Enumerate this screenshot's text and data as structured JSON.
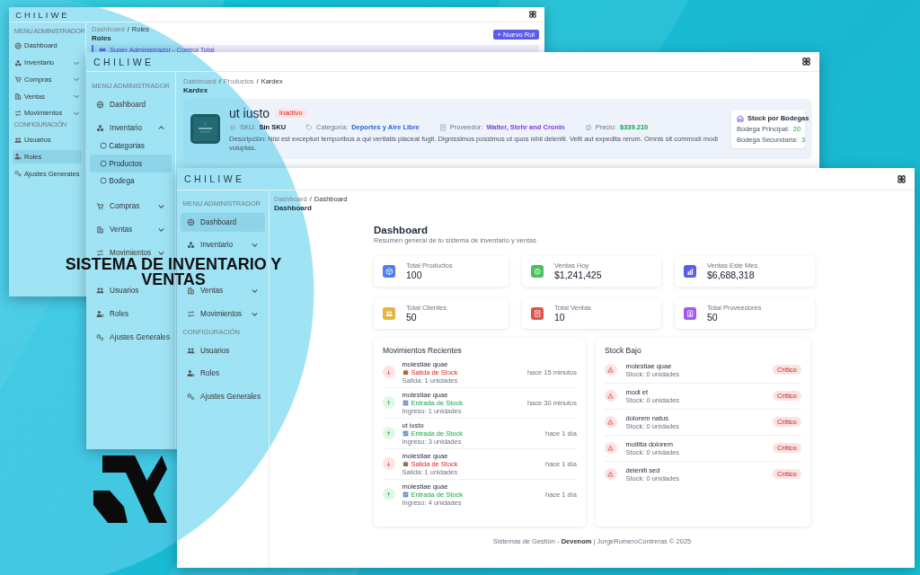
{
  "headline": [
    "SISTEMA DE INVENTARIO Y",
    "VENTAS"
  ],
  "windows": [
    {
      "kind": "roles",
      "logo": "CHILIWE",
      "sidebar": [
        {
          "kind": "heading",
          "label": "MENU ADMINISTRADOR"
        },
        {
          "kind": "link",
          "label": "Dashboard",
          "selected": false
        },
        {
          "kind": "group",
          "label": "Inventario",
          "selected": false,
          "expanded": false
        },
        {
          "kind": "group",
          "label": "Compras",
          "selected": false,
          "expanded": false
        },
        {
          "kind": "group",
          "label": "Ventas",
          "selected": false,
          "expanded": false
        },
        {
          "kind": "group",
          "label": "Movimientos",
          "selected": false,
          "expanded": false
        },
        {
          "kind": "heading",
          "label": "CONFIGURACIÓN"
        },
        {
          "kind": "link",
          "label": "Usuarios",
          "selected": false
        },
        {
          "kind": "link",
          "label": "Roles",
          "selected": true
        },
        {
          "kind": "link",
          "label": "Ajustes Generales",
          "selected": false
        }
      ],
      "breadcrumb": [
        "Dashboard",
        "Roles"
      ],
      "breadcrumb_separator": "/",
      "page_title": "Roles",
      "button": "+ Nuevo Rol",
      "banner": "Super Administrador - Control Total"
    },
    {
      "kind": "kardex",
      "logo": "CHILIWE",
      "sidebar": [
        {
          "kind": "heading",
          "label": "MENU ADMINISTRADOR"
        },
        {
          "kind": "link",
          "label": "Dashboard",
          "selected": false
        },
        {
          "kind": "group",
          "label": "Inventario",
          "selected": false,
          "expanded": true,
          "children": [
            {
              "label": "Categorias",
              "selected": false
            },
            {
              "label": "Productos",
              "selected": true
            },
            {
              "label": "Bodega",
              "selected": false
            }
          ]
        },
        {
          "kind": "group",
          "label": "Compras",
          "selected": false,
          "expanded": false
        },
        {
          "kind": "group",
          "label": "Ventas",
          "selected": false,
          "expanded": false
        },
        {
          "kind": "group",
          "label": "Movimientos",
          "selected": false,
          "expanded": false
        },
        {
          "kind": "heading"
        },
        {
          "kind": "link",
          "label": "Usuarios",
          "selected": false
        },
        {
          "kind": "link",
          "label": "Roles",
          "selected": false
        },
        {
          "kind": "link",
          "label": "Ajustes Generales",
          "selected": false
        }
      ],
      "breadcrumb": [
        "Dashboard",
        "Productos",
        "Kardex"
      ],
      "breadcrumb_separator": "/",
      "page_title": "Kardex",
      "product": {
        "name": "ut iusto",
        "status": "Inactivo",
        "fields": [
          {
            "label": "SKU:",
            "value": "Sin SKU",
            "color": "#111827"
          },
          {
            "label": "Categoría:",
            "value": "Deportes y Aire Libre",
            "color": "#2563eb"
          },
          {
            "label": "Proveedor:",
            "value": "Walter, Stehr and Cronin",
            "color": "#7c3aed"
          },
          {
            "label": "Precio:",
            "value": "$339.210",
            "color": "#16a34a"
          }
        ],
        "description": "Descripción: Nisi est excepturi temporibus a qui veritatis placeat fugit. Dignissimos possimus ut quos nihil deleniti. Velit aut expedita rerum. Omnis sit commodi modi voluptas."
      },
      "stock_box": {
        "title": "Stock por Bodegas",
        "rows": [
          {
            "label": "Bodega Principal:",
            "value": "20"
          },
          {
            "label": "Bodega Secundaria:",
            "value": "3"
          }
        ]
      }
    },
    {
      "kind": "dashboard",
      "logo": "CHILIWE",
      "sidebar": [
        {
          "kind": "heading",
          "label": "MENU ADMINISTRADOR"
        },
        {
          "kind": "link",
          "label": "Dashboard",
          "selected": true
        },
        {
          "kind": "group",
          "label": "Inventario",
          "selected": false,
          "expanded": false
        },
        {
          "kind": "group"
        },
        {
          "kind": "group",
          "label": "Ventas",
          "selected": false,
          "expanded": false
        },
        {
          "kind": "group",
          "label": "Movimientos",
          "selected": false,
          "expanded": false
        },
        {
          "kind": "heading",
          "label": "CONFIGURACIÓN"
        },
        {
          "kind": "link",
          "label": "Usuarios",
          "selected": false
        },
        {
          "kind": "link",
          "label": "Roles",
          "selected": false
        },
        {
          "kind": "link",
          "label": "Ajustes Generales",
          "selected": false
        }
      ],
      "breadcrumb": [
        "Dashboard",
        "Dashboard"
      ],
      "breadcrumb_separator": "/",
      "page_title": "Dashboard",
      "dashboard": {
        "heading": "Dashboard",
        "subtitle": "Resumen general de tu sistema de inventario y ventas",
        "stats": [
          {
            "label": "Total Productos",
            "value": "100",
            "color": "#4f7ef0"
          },
          {
            "label": "Ventas Hoy",
            "value": "$1,241,425",
            "color": "#4cbf5f"
          },
          {
            "label": "Ventas Este Mes",
            "value": "$6,688,318",
            "color": "#5b5ce8"
          },
          {
            "label": "Total Clientes",
            "value": "50",
            "color": "#e6b53c"
          },
          {
            "label": "Total Ventas",
            "value": "10",
            "color": "#e0524c"
          },
          {
            "label": "Total Proveedores",
            "value": "50",
            "color": "#a05af0"
          }
        ],
        "movements_title": "Movimientos Recientes",
        "movements": [
          {
            "kind": "out",
            "product": "molestiae quae",
            "type": "Salida de Stock",
            "detail": "Salida: 1 unidades",
            "time": "hace 15 minutos"
          },
          {
            "kind": "in",
            "product": "molestiae quae",
            "type": "Entrada de Stock",
            "detail": "Ingreso: 1 unidades",
            "time": "hace 30 minutos"
          },
          {
            "kind": "in",
            "product": "ut iusto",
            "type": "Entrada de Stock",
            "detail": "Ingreso: 3 unidades",
            "time": "hace 1 día"
          },
          {
            "kind": "out",
            "product": "molestiae quae",
            "type": "Salida de Stock",
            "detail": "Salida: 1 unidades",
            "time": "hace 1 día"
          },
          {
            "kind": "in",
            "product": "molestiae quae",
            "type": "Entrada de Stock",
            "detail": "Ingreso: 4 unidades",
            "time": "hace 1 día"
          }
        ],
        "low_stock_title": "Stock Bajo",
        "low_stock": [
          {
            "name": "molestiae quae",
            "stock": "Stock: 0 unidades",
            "badge": "Crítico"
          },
          {
            "name": "modi et",
            "stock": "Stock: 0 unidades",
            "badge": "Crítico"
          },
          {
            "name": "dolorem natus",
            "stock": "Stock: 0 unidades",
            "badge": "Crítico"
          },
          {
            "name": "mollitia dolorem",
            "stock": "Stock: 0 unidades",
            "badge": "Crítico"
          },
          {
            "name": "deleniti sed",
            "stock": "Stock: 0 unidades",
            "badge": "Crítico"
          }
        ]
      },
      "footer": "Sistemas de Gestión - **Devenom** | JorgeRomeroContreras © 2025"
    }
  ]
}
